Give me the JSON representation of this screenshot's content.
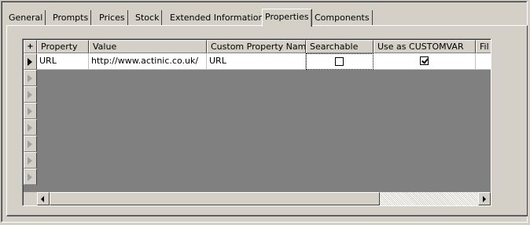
{
  "tabs": [
    {
      "label": "General",
      "selected": false
    },
    {
      "label": "Prompts",
      "selected": false
    },
    {
      "label": "Prices",
      "selected": false
    },
    {
      "label": "Stock",
      "selected": false
    },
    {
      "label": "Extended Information",
      "selected": false
    },
    {
      "label": "Properties",
      "selected": true
    },
    {
      "label": "Components",
      "selected": false
    }
  ],
  "grid": {
    "corner_label": "+",
    "columns": [
      "Property",
      "Value",
      "Custom Property Name",
      "Searchable",
      "Use as CUSTOMVAR",
      "Fil"
    ],
    "rows": [
      {
        "property": "URL",
        "value": "http://www.actinic.co.uk/",
        "custom_name": "URL",
        "searchable": false,
        "use_as_customvar": true,
        "fil": ""
      }
    ],
    "empty_row_count": 7
  }
}
